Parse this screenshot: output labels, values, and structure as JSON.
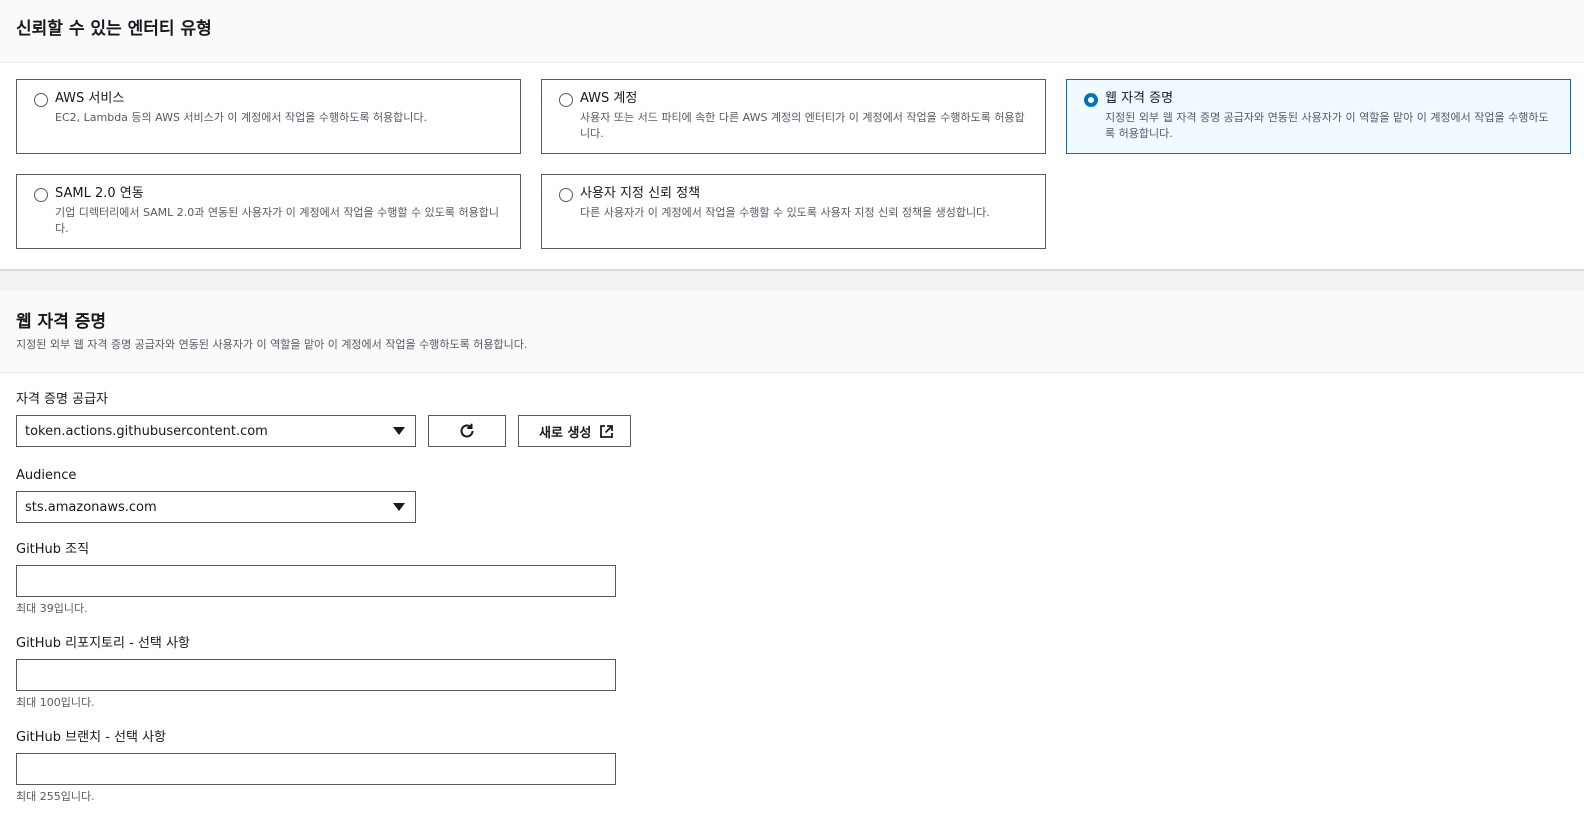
{
  "trusted_entity": {
    "title": "신뢰할 수 있는 엔터티 유형",
    "options": [
      {
        "label": "AWS 서비스",
        "description": "EC2, Lambda 등의 AWS 서비스가 이 계정에서 작업을 수행하도록 허용합니다.",
        "selected": false
      },
      {
        "label": "AWS 계정",
        "description": "사용자 또는 서드 파티에 속한 다른 AWS 계정의 엔터티가 이 계정에서 작업을 수행하도록 허용합니다.",
        "selected": false
      },
      {
        "label": "웹 자격 증명",
        "description": "지정된 외부 웹 자격 증명 공급자와 연동된 사용자가 이 역할을 맡아 이 계정에서 작업을 수행하도록 허용합니다.",
        "selected": true
      },
      {
        "label": "SAML 2.0 연동",
        "description": "기업 디렉터리에서 SAML 2.0과 연동된 사용자가 이 계정에서 작업을 수행할 수 있도록 허용합니다.",
        "selected": false
      },
      {
        "label": "사용자 지정 신뢰 정책",
        "description": "다른 사용자가 이 계정에서 작업을 수행할 수 있도록 사용자 지정 신뢰 정책을 생성합니다.",
        "selected": false
      }
    ]
  },
  "web_identity": {
    "title": "웹 자격 증명",
    "description": "지정된 외부 웹 자격 증명 공급자와 연동된 사용자가 이 역할을 맡아 이 계정에서 작업을 수행하도록 허용합니다.",
    "provider_label": "자격 증명 공급자",
    "provider_value": "token.actions.githubusercontent.com",
    "create_new_label": "새로 생성",
    "audience_label": "Audience",
    "audience_value": "sts.amazonaws.com",
    "org_label": "GitHub 조직",
    "org_value": "",
    "org_hint": "최대 39입니다.",
    "repo_label": "GitHub 리포지토리 - 선택 사항",
    "repo_value": "",
    "repo_hint": "최대 100입니다.",
    "branch_label": "GitHub 브랜치 - 선택 사항",
    "branch_value": "",
    "branch_hint": "최대 255입니다."
  },
  "icons": {
    "refresh": "refresh-icon",
    "external": "external-link-icon",
    "dropdown": "caret-down-icon"
  },
  "colors": {
    "accent": "#0073bb",
    "selected_bg": "#f1faff",
    "border": "#545b64",
    "text": "#16191f",
    "muted": "#545b64"
  }
}
